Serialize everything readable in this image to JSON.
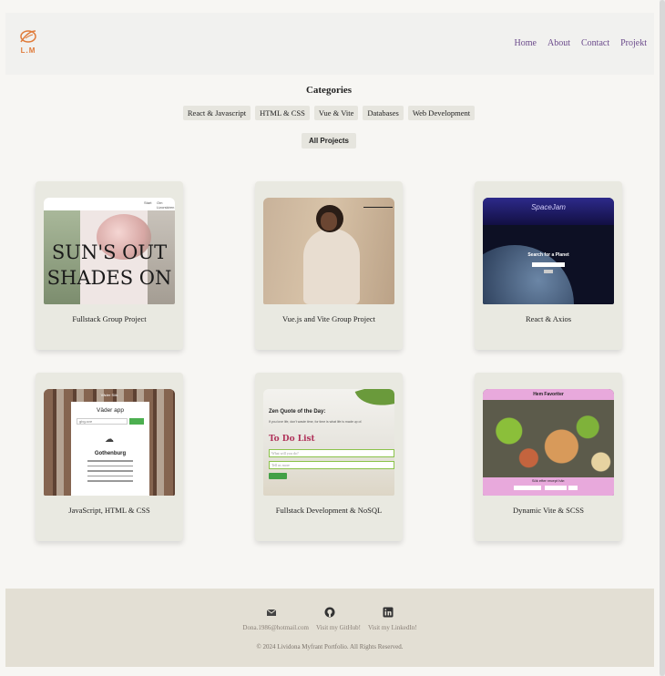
{
  "header": {
    "logo_text": "L.M",
    "nav": [
      "Home",
      "About",
      "Contact",
      "Projekt"
    ]
  },
  "categories": {
    "title": "Categories",
    "chips": [
      "React & Javascript",
      "HTML & CSS",
      "Vue & Vite",
      "Databases",
      "Web Development"
    ],
    "all_label": "All Projects"
  },
  "projects": [
    {
      "title": "Fullstack Group Project",
      "thumb": {
        "headline_line1": "SUN'S OUT",
        "headline_line2": "SHADES ON",
        "nav_a": "Start",
        "nav_b": "Om Lizorskiren"
      }
    },
    {
      "title": "Vue.js and Vite Group Project"
    },
    {
      "title": "React & Axios",
      "thumb": {
        "app_title": "SpaceJam",
        "search_label": "Search for a Planet"
      }
    },
    {
      "title": "JavaScript, HTML & CSS",
      "thumb": {
        "app_title": "Väder app",
        "input_value": "gbg-sve",
        "city": "Gothenburg",
        "nav": "Väder  Sök"
      }
    },
    {
      "title": "Fullstack Development & NoSQL",
      "thumb": {
        "zen_title": "Zen Quote of the Day:",
        "quote": "If you love life, don't waste time, for time is what life is made up of.",
        "todo_title": "To Do List",
        "field1": "What will you do?",
        "field2": "Tell us more"
      }
    },
    {
      "title": "Dynamic Vite & SCSS",
      "thumb": {
        "nav": "Hem  Favoriter",
        "prompt": "Sök efter recept här:"
      }
    }
  ],
  "footer": {
    "email": "Dona.1986@hotmail.com",
    "github": "Visit my GitHub!",
    "linkedin": "Visit my LinkedIn!",
    "copyright": "© 2024 Lividona Myfrant Portfolio. All Rights Reserved."
  },
  "icons": {
    "logo": "leaf-logo-icon",
    "email": "envelope-icon",
    "github": "github-icon",
    "linkedin": "linkedin-icon"
  },
  "colors": {
    "nav_link": "#6b4a8b",
    "card_bg": "#e9e9e1",
    "footer_bg": "#e3dfd4"
  }
}
